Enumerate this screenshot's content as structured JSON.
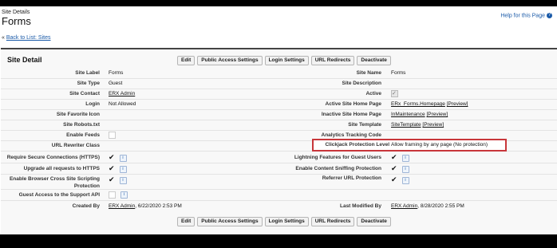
{
  "header": {
    "small_title": "Site Details",
    "title": "Forms",
    "help_link": "Help for this Page"
  },
  "back_link": {
    "prefix": "« ",
    "label": "Back to List: Sites"
  },
  "section_title": "Site Detail",
  "buttons": [
    "Edit",
    "Public Access Settings",
    "Login Settings",
    "URL Redirects",
    "Deactivate"
  ],
  "fields": {
    "site_label": {
      "label": "Site Label",
      "value": "Forms"
    },
    "site_name": {
      "label": "Site Name",
      "value": "Forms"
    },
    "site_type": {
      "label": "Site Type",
      "value": "Guest"
    },
    "site_description": {
      "label": "Site Description",
      "value": ""
    },
    "site_contact": {
      "label": "Site Contact",
      "value": "ERX Admin"
    },
    "active": {
      "label": "Active"
    },
    "login": {
      "label": "Login",
      "value": "Not Allowed"
    },
    "active_home": {
      "label": "Active Site Home Page",
      "value": "ERx_Forms.Homepage",
      "preview": "[Preview]"
    },
    "favicon": {
      "label": "Site Favorite Icon"
    },
    "inactive_home": {
      "label": "Inactive Site Home Page",
      "value": "InMaintenance",
      "preview": "[Preview]"
    },
    "robots": {
      "label": "Site Robots.txt"
    },
    "site_template": {
      "label": "Site Template",
      "value": "SiteTemplate",
      "preview": "[Preview]"
    },
    "enable_feeds": {
      "label": "Enable Feeds"
    },
    "analytics": {
      "label": "Analytics Tracking Code"
    },
    "url_rewriter": {
      "label": "URL Rewriter Class"
    },
    "clickjack": {
      "label": "Clickjack Protection Level",
      "value": "Allow framing by any page (No protection)"
    },
    "secure_conn": {
      "label": "Require Secure Connections (HTTPS)"
    },
    "lightning_guest": {
      "label": "Lightning Features for Guest Users"
    },
    "upgrade_https": {
      "label": "Upgrade all requests to HTTPS"
    },
    "content_sniff": {
      "label": "Enable Content Sniffing Protection"
    },
    "xss_line1": {
      "label": "Enable Browser Cross Site Scripting"
    },
    "xss_line2": {
      "label": "Protection"
    },
    "referrer": {
      "label": "Referrer URL Protection"
    },
    "guest_support": {
      "label": "Guest Access to the Support API"
    },
    "created_by": {
      "label": "Created By",
      "user": "ERX Admin",
      "date": ", 6/22/2020 2:53 PM"
    },
    "last_modified": {
      "label": "Last Modified By",
      "user": "ERX Admin",
      "date": ", 8/28/2020 2:55 PM"
    }
  },
  "glyphs": {
    "check": "✔",
    "info": "i"
  },
  "colors": {
    "link": "#1a5aa8",
    "highlight_border": "#c8363a",
    "section_border": "#444444"
  }
}
